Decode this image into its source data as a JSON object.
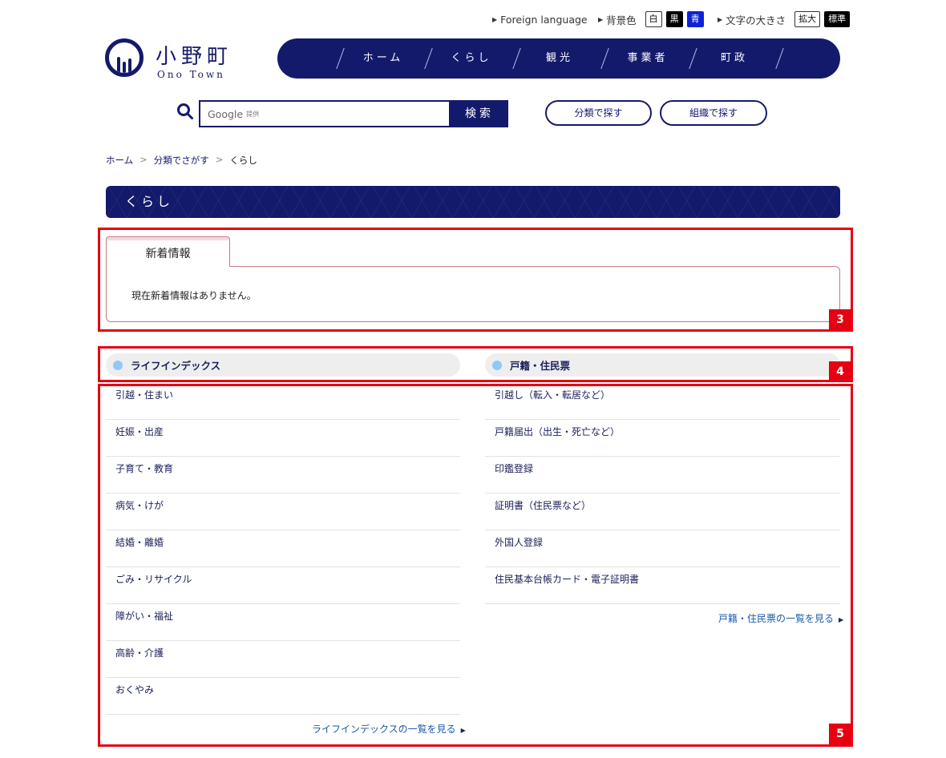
{
  "utility": {
    "foreign_language": "Foreign language",
    "bg_color_label": "背景色",
    "bg_white": "白",
    "bg_black": "黒",
    "bg_blue": "青",
    "font_size_label": "文字の大きさ",
    "font_enlarge": "拡大",
    "font_standard": "標準"
  },
  "logo": {
    "jp": "小野町",
    "en": "Ono Town"
  },
  "nav": {
    "items": [
      "ホーム",
      "くらし",
      "観光",
      "事業者",
      "町政"
    ]
  },
  "search": {
    "provider": "Google",
    "provider_note": "提供",
    "button": "検索",
    "by_category": "分類で探す",
    "by_organization": "組織で探す"
  },
  "breadcrumb": {
    "home": "ホーム",
    "category": "分類でさがす",
    "current": "くらし",
    "sep": ">"
  },
  "page_title": "くらし",
  "news": {
    "tab": "新着情報",
    "message": "現在新着情報はありません。"
  },
  "annotations": {
    "tag3": "3",
    "tag4": "4",
    "tag5": "5"
  },
  "categories": {
    "life_index": {
      "title": "ライフインデックス",
      "items": [
        "引越・住まい",
        "妊娠・出産",
        "子育て・教育",
        "病気・けが",
        "結婚・離婚",
        "ごみ・リサイクル",
        "障がい・福祉",
        "高齢・介護",
        "おくやみ"
      ],
      "more": "ライフインデックスの一覧を見る"
    },
    "family_register": {
      "title": "戸籍・住民票",
      "items": [
        "引越し（転入・転居など）",
        "戸籍届出（出生・死亡など）",
        "印鑑登録",
        "証明書（住民票など）",
        "外国人登録",
        "住民基本台帳カード・電子証明書"
      ],
      "more": "戸籍・住民票の一覧を見る"
    }
  },
  "colors": {
    "brand": "#141a6b",
    "annotation": "#e60012",
    "bullet": "#8fc9f5"
  }
}
